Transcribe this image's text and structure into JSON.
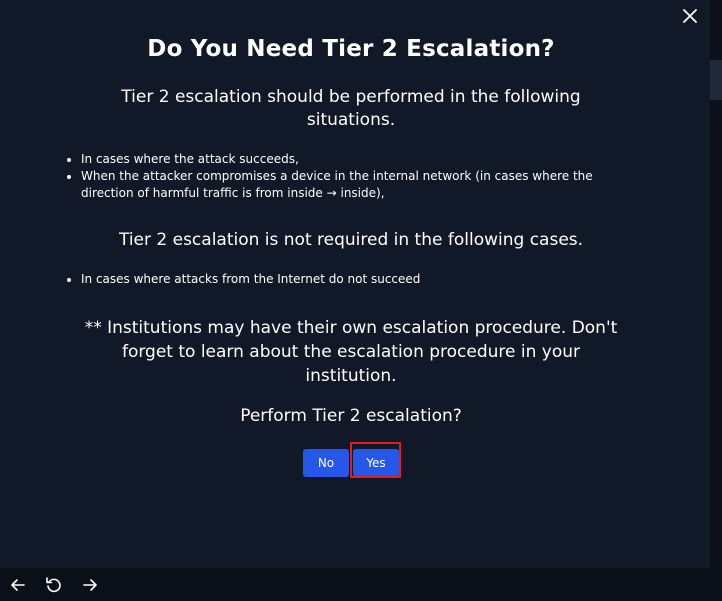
{
  "dialog": {
    "title": "Do You Need Tier 2 Escalation?",
    "subtitle": "Tier 2 escalation should be performed in the following situations.",
    "required_cases": [
      "In cases where the attack succeeds,",
      "When the attacker compromises a device in the internal network (in cases where the direction of harmful traffic is from inside → inside),"
    ],
    "not_required_heading": "Tier 2 escalation is not required in the following cases.",
    "not_required_cases": [
      "In cases where attacks from the Internet do not succeed"
    ],
    "note": "** Institutions may have their own escalation procedure. Don't forget to learn about the escalation procedure in your institution.",
    "question": "Perform Tier 2 escalation?",
    "no_label": "No",
    "yes_label": "Yes"
  },
  "icons": {
    "close": "close-icon",
    "back": "arrow-left-icon",
    "refresh": "refresh-icon",
    "forward": "arrow-right-icon"
  },
  "colors": {
    "background": "#111827",
    "button": "#2557e8",
    "highlight": "#e11d1d"
  }
}
